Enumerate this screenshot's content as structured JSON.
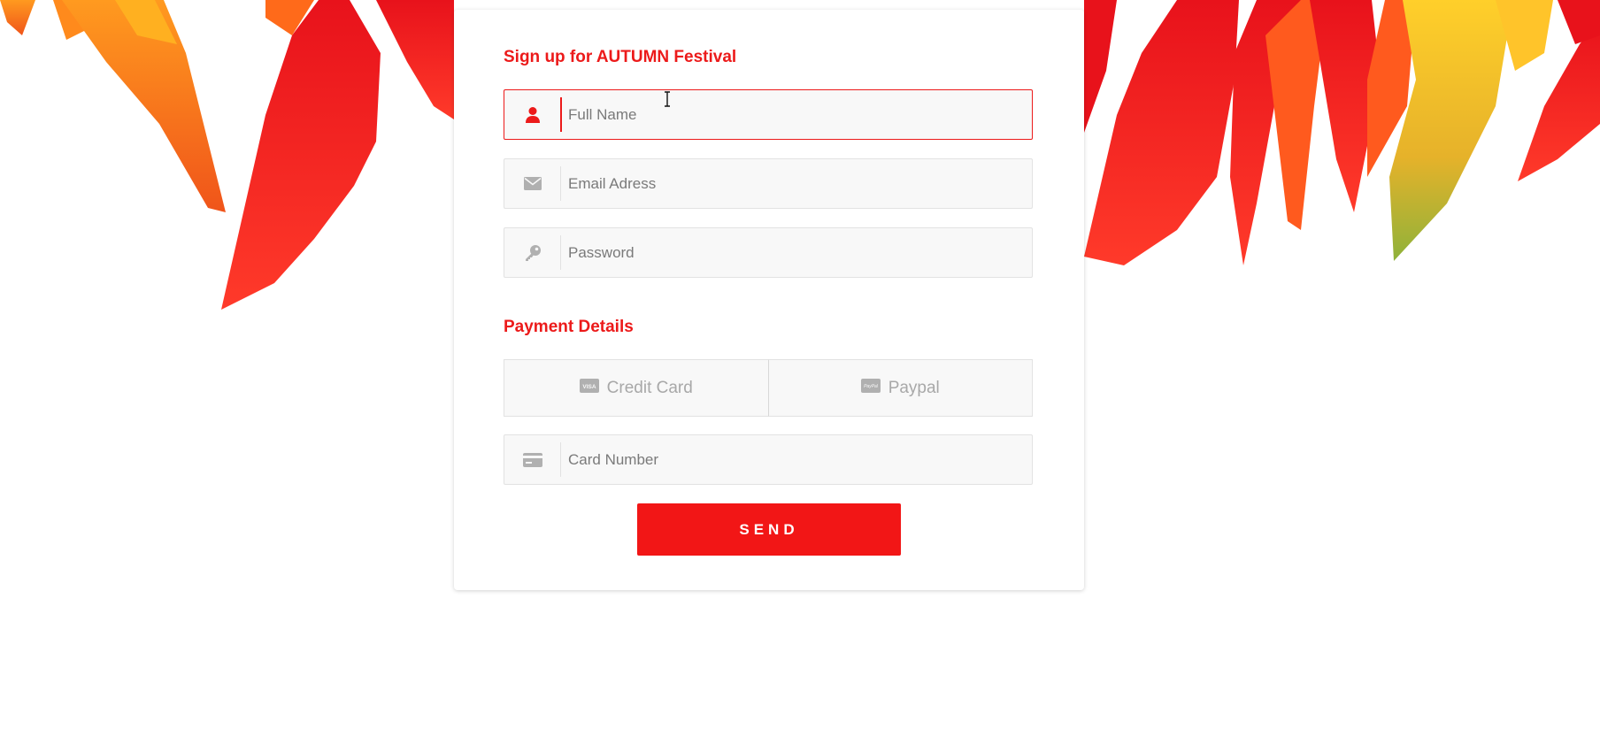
{
  "form": {
    "title": "Sign up for AUTUMN Festival",
    "fields": [
      {
        "icon": "user-icon",
        "placeholder": "Full Name",
        "value": "",
        "focused": true
      },
      {
        "icon": "envelope-icon",
        "placeholder": "Email Adress",
        "value": "",
        "focused": false
      },
      {
        "icon": "key-icon",
        "placeholder": "Password",
        "value": "",
        "focused": false
      }
    ]
  },
  "payment": {
    "title": "Payment Details",
    "options": [
      {
        "icon": "visa-card-icon",
        "label": "Credit Card",
        "icon_text": "VISA"
      },
      {
        "icon": "paypal-icon",
        "label": "Paypal",
        "icon_text": "PayPal"
      }
    ],
    "card_field": {
      "icon": "credit-card-icon",
      "placeholder": "Card Number",
      "value": ""
    }
  },
  "send_label": "SEND",
  "colors": {
    "accent": "#ec1a1a",
    "button": "#f21616",
    "field_bg": "#f8f8f8",
    "muted_icon": "#b0b0b0"
  }
}
